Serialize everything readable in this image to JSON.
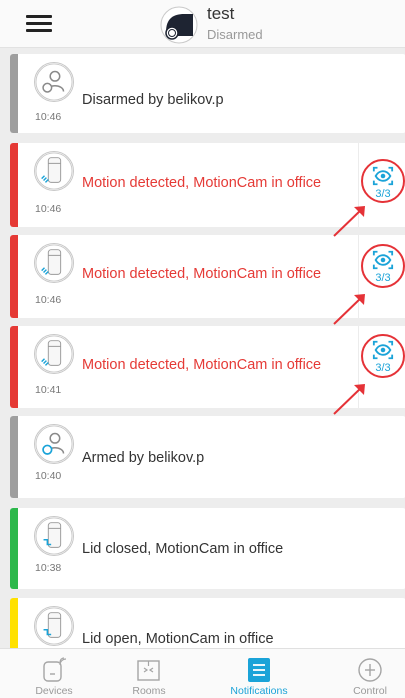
{
  "header": {
    "hub_name": "test",
    "hub_status": "Disarmed",
    "menu_icon": "hamburger-menu-icon",
    "hub_icon": "hub-device-icon"
  },
  "notifications": [
    {
      "message": "Disarmed by belikov.p",
      "time": "10:46",
      "type": "disarm",
      "stripe_color": "#9e9e9e",
      "text_color": "#333333",
      "icon": "user-disarm-icon"
    },
    {
      "message": "Motion detected, MotionCam in office",
      "time": "10:46",
      "type": "alarm",
      "stripe_color": "#e53935",
      "text_color": "#e53a36",
      "icon": "motioncam-motion-icon",
      "photo_count": "3/3",
      "photo_icon": "eye-scan-icon"
    },
    {
      "message": "Motion detected, MotionCam in office",
      "time": "10:46",
      "type": "alarm",
      "stripe_color": "#e53935",
      "text_color": "#e53a36",
      "icon": "motioncam-motion-icon",
      "photo_count": "3/3",
      "photo_icon": "eye-scan-icon"
    },
    {
      "message": "Motion detected, MotionCam in office",
      "time": "10:41",
      "type": "alarm",
      "stripe_color": "#e53935",
      "text_color": "#e53a36",
      "icon": "motioncam-motion-icon",
      "photo_count": "3/3",
      "photo_icon": "eye-scan-icon"
    },
    {
      "message": "Armed by belikov.p",
      "time": "10:40",
      "type": "arm",
      "stripe_color": "#9e9e9e",
      "text_color": "#333333",
      "icon": "user-arm-icon"
    },
    {
      "message": "Lid closed, MotionCam in office",
      "time": "10:38",
      "type": "lid",
      "stripe_color": "#2db84b",
      "text_color": "#333333",
      "icon": "motioncam-lid-icon"
    },
    {
      "message": "Lid open, MotionCam in office",
      "time": "",
      "type": "lid",
      "stripe_color": "#ffe100",
      "text_color": "#333333",
      "icon": "motioncam-lid-icon"
    }
  ],
  "annotation_color": "#e53237",
  "accent_color": "#1aa3d8",
  "nav": {
    "tabs": [
      {
        "label": "Devices",
        "icon": "devices-icon",
        "active": false
      },
      {
        "label": "Rooms",
        "icon": "rooms-icon",
        "active": false
      },
      {
        "label": "Notifications",
        "icon": "notifications-icon",
        "active": true
      },
      {
        "label": "Control",
        "icon": "control-icon",
        "active": false
      }
    ]
  }
}
